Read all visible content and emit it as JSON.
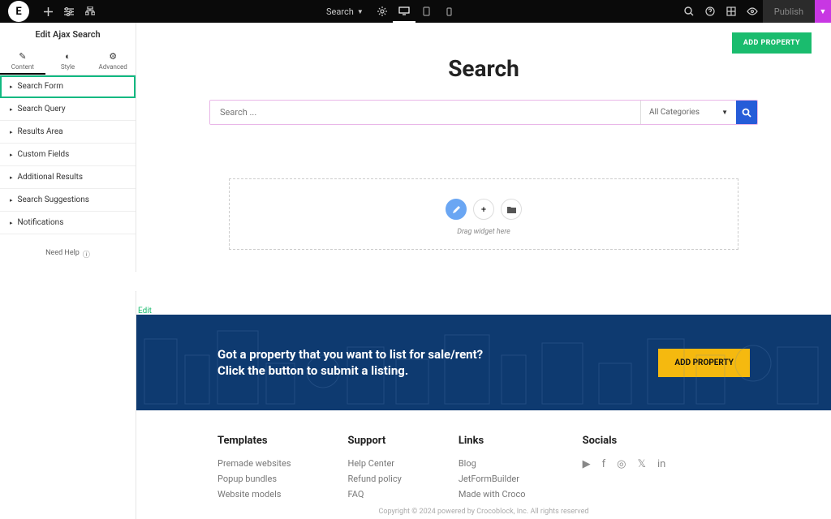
{
  "topbar": {
    "search_label": "Search",
    "publish_label": "Publish"
  },
  "panel": {
    "title": "Edit Ajax Search",
    "tabs": {
      "content": "Content",
      "style": "Style",
      "advanced": "Advanced"
    },
    "sections": {
      "search_form": "Search Form",
      "search_query": "Search Query",
      "results_area": "Results Area",
      "custom_fields": "Custom Fields",
      "additional_results": "Additional Results",
      "search_suggestions": "Search Suggestions",
      "notifications": "Notifications"
    },
    "need_help": "Need Help"
  },
  "canvas": {
    "add_property_top": "ADD PROPERTY",
    "page_title": "Search",
    "search_placeholder": "Search ...",
    "categories_label": "All Categories",
    "drag_widget": "Drag widget here",
    "edit_link": "Edit"
  },
  "cta": {
    "line1": "Got a property that you want to list for sale/rent?",
    "line2": "Click the button to submit a listing.",
    "button": "ADD PROPERTY"
  },
  "footer": {
    "templates": {
      "heading": "Templates",
      "links": [
        "Premade websites",
        "Popup bundles",
        "Website models"
      ]
    },
    "support": {
      "heading": "Support",
      "links": [
        "Help Center",
        "Refund policy",
        "FAQ"
      ]
    },
    "links": {
      "heading": "Links",
      "links": [
        "Blog",
        "JetFormBuilder",
        "Made with Croco"
      ]
    },
    "socials": {
      "heading": "Socials"
    },
    "copyright": "Copyright © 2024 powered by Crocoblock, Inc. All rights reserved"
  }
}
